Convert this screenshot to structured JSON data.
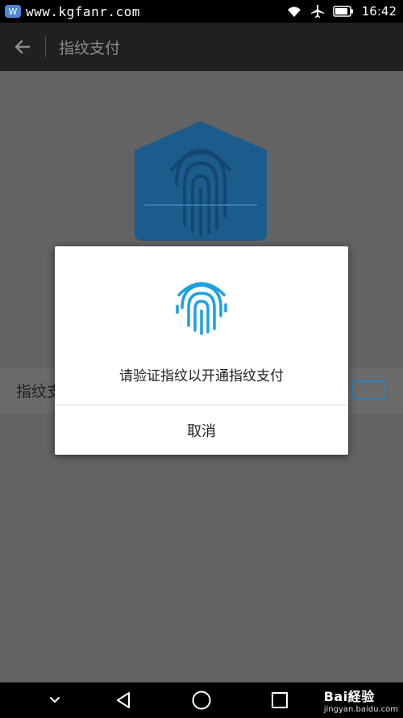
{
  "status_bar": {
    "site_text": "www.kgfanr.com",
    "time": "16:42",
    "icons": [
      "wifi-icon",
      "airplane-icon",
      "battery-icon"
    ]
  },
  "app_bar": {
    "back_icon": "arrow-left-icon",
    "title": "指纹支付"
  },
  "settings_row": {
    "label": "指纹支付"
  },
  "dialog": {
    "icon": "fingerprint-icon",
    "message": "请验证指纹以开通指纹支付",
    "cancel_label": "取消"
  },
  "nav_bar": {
    "icons": [
      "chevron-down-icon",
      "back-triangle-icon",
      "home-circle-icon",
      "recents-square-icon"
    ]
  },
  "watermark": {
    "brand": "Bai経验",
    "url": "jingyan.baidu.com"
  },
  "colors": {
    "accent": "#1ea0e0",
    "hero_blue": "#1b5c8c",
    "overlay": "#636363"
  }
}
